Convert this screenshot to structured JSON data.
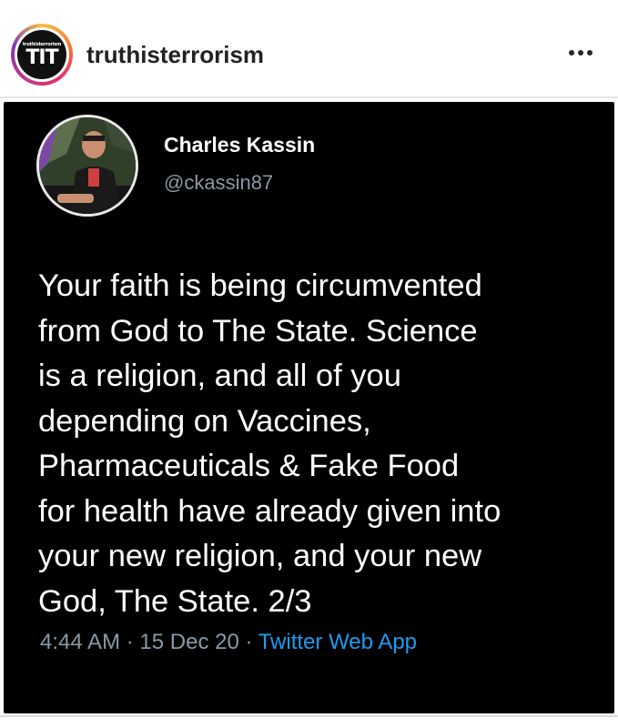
{
  "post": {
    "username": "truthisterrorism",
    "avatar_small_text": "truthisterrorism",
    "avatar_logo_text": "TIT",
    "more_icon": "more-dots-icon"
  },
  "tweet": {
    "name": "Charles Kassin",
    "handle": "@ckassin87",
    "text_lines": [
      "Your faith is being circumvented",
      "from God to The State. Science",
      "is a religion, and all of you",
      "depending on Vaccines,",
      "Pharmaceuticals & Fake Food",
      "for health have already given into",
      "your new religion, and your new",
      "God, The State. 2/3"
    ],
    "time": "4:44 AM",
    "sep1": "·",
    "date": "15 Dec 20",
    "sep2": "·",
    "source": "Twitter Web App"
  },
  "colors": {
    "tweet_background": "#000000",
    "tweet_text": "#ffffff",
    "muted_text": "#8b98a5",
    "link_blue": "#1d9bf0"
  }
}
